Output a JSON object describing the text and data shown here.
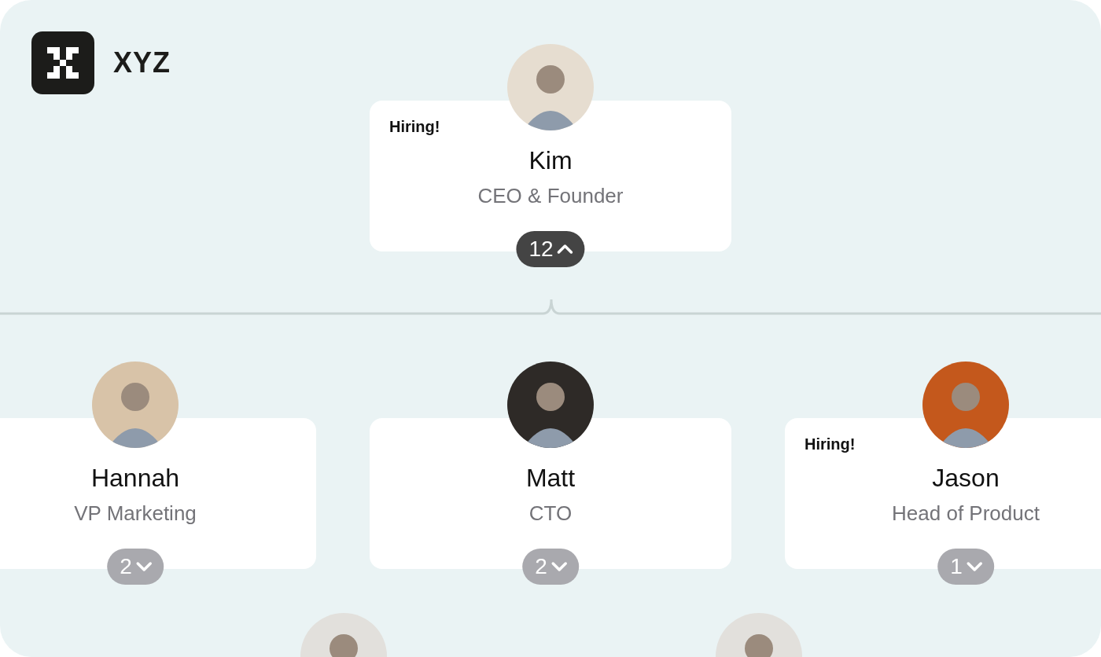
{
  "brand": {
    "name": "XYZ"
  },
  "root": {
    "name": "Kim",
    "title": "CEO & Founder",
    "tag": "Hiring!",
    "count": "12",
    "expanded": true,
    "children": [
      {
        "name": "Hannah",
        "title": "VP Marketing",
        "count": "2",
        "expanded": false
      },
      {
        "name": "Matt",
        "title": "CTO",
        "count": "2",
        "expanded": false
      },
      {
        "name": "Jason",
        "title": "Head of Product",
        "tag": "Hiring!",
        "count": "1",
        "expanded": false
      }
    ]
  }
}
